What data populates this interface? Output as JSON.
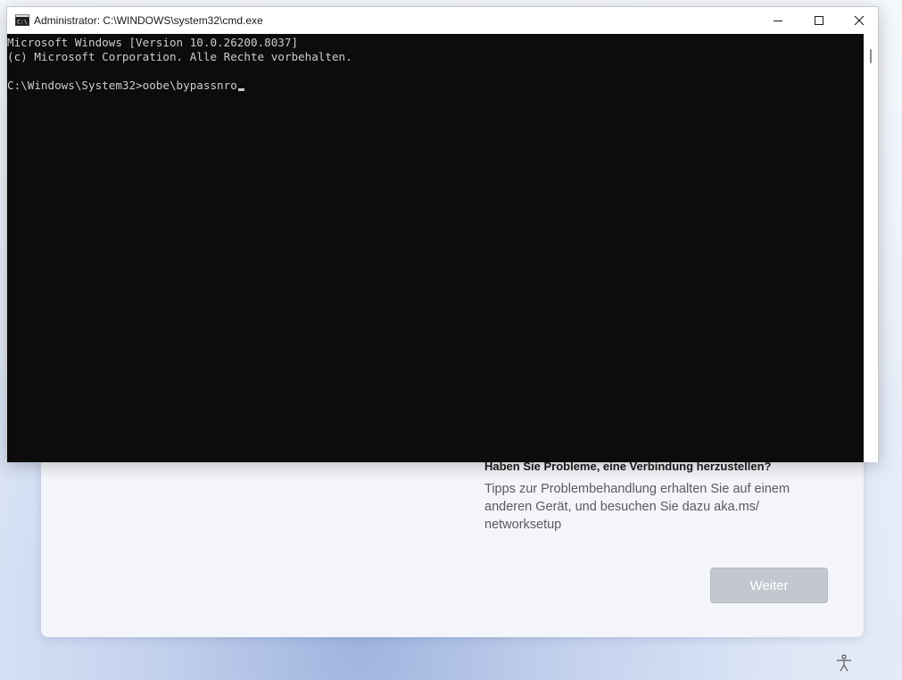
{
  "window": {
    "title": "Administrator: C:\\WINDOWS\\system32\\cmd.exe",
    "icon": "cmd-icon",
    "controls": [
      "minimize-icon",
      "maximize-icon",
      "close-icon"
    ]
  },
  "console": {
    "lines": [
      "Microsoft Windows [Version 10.0.26200.8037]",
      "(c) Microsoft Corporation. Alle Rechte vorbehalten.",
      "",
      "C:\\Windows\\System32>oobe\\bypassnro"
    ],
    "background": "#0c0c0c",
    "foreground": "#cccccc"
  },
  "oobe": {
    "trouble_heading": "Haben Sie Probleme, eine Verbindung herzustellen?",
    "trouble_body": "Tipps zur Problembehandlung erhalten Sie auf einem anderen Gerät, und besuchen Sie dazu aka.ms/ networksetup",
    "next_label": "Weiter",
    "next_enabled": false
  },
  "taskbar": {
    "accessibility_icon": "accessibility-icon"
  }
}
